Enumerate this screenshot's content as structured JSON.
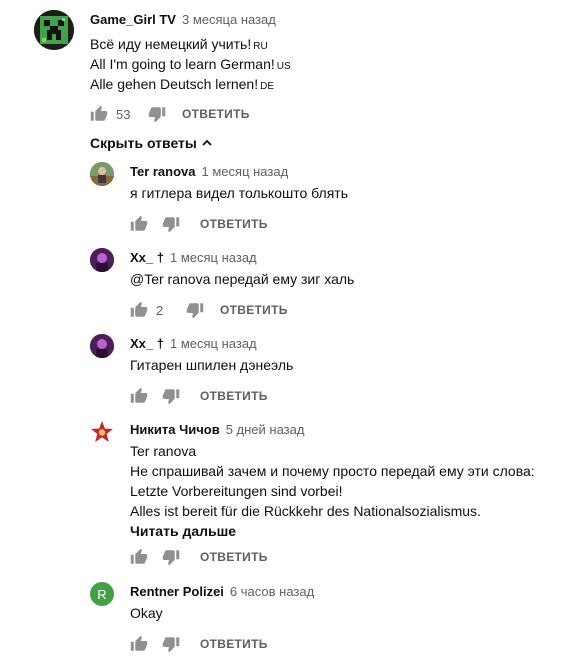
{
  "comments": {
    "main": {
      "author": "Game_Girl TV",
      "time": "3 месяца назад",
      "lines": [
        {
          "text": "Всё иду немецкий учить!",
          "tag": "RU"
        },
        {
          "text": "All I'm going to learn German!",
          "tag": "US"
        },
        {
          "text": "Alle gehen Deutsch lernen!",
          "tag": "DE"
        }
      ],
      "likes": "53",
      "reply": "ОТВЕТИТЬ"
    },
    "toggle": "Скрыть ответы",
    "replies": [
      {
        "author": "Ter ranova",
        "time": "1 месяц назад",
        "lines": [
          "я гитлера видел толькошто блять"
        ],
        "likes": "",
        "reply": "ОТВЕТИТЬ"
      },
      {
        "author": "Xx_ †",
        "time": "1 месяц назад",
        "lines": [
          "@Ter ranova передай ему зиг халь"
        ],
        "likes": "2",
        "reply": "ОТВЕТИТЬ"
      },
      {
        "author": "Xx_ †",
        "time": "1 месяц назад",
        "lines": [
          "Гитарен шпилен дэнеэль"
        ],
        "likes": "",
        "reply": "ОТВЕТИТЬ"
      },
      {
        "author": "Никита Чичов",
        "time": "5 дней назад",
        "lines": [
          "Ter ranova",
          "Не спрашивай зачем и почему просто передай ему эти слова:",
          "Letzte Vorbereitungen sind vorbei!",
          "Alles ist bereit für die Rückkehr des Nationalsozialismus."
        ],
        "readmore": "Читать дальше",
        "likes": "",
        "reply": "ОТВЕТИТЬ"
      },
      {
        "author": "Rentner Polizei",
        "time": "6 часов назад",
        "lines": [
          "Okay"
        ],
        "likes": "",
        "reply": "ОТВЕТИТЬ",
        "avatar_letter": "R"
      }
    ]
  },
  "colors": {
    "secondary_text": "#606060",
    "avatar_green": "#43a047",
    "star_red": "#c62828"
  }
}
